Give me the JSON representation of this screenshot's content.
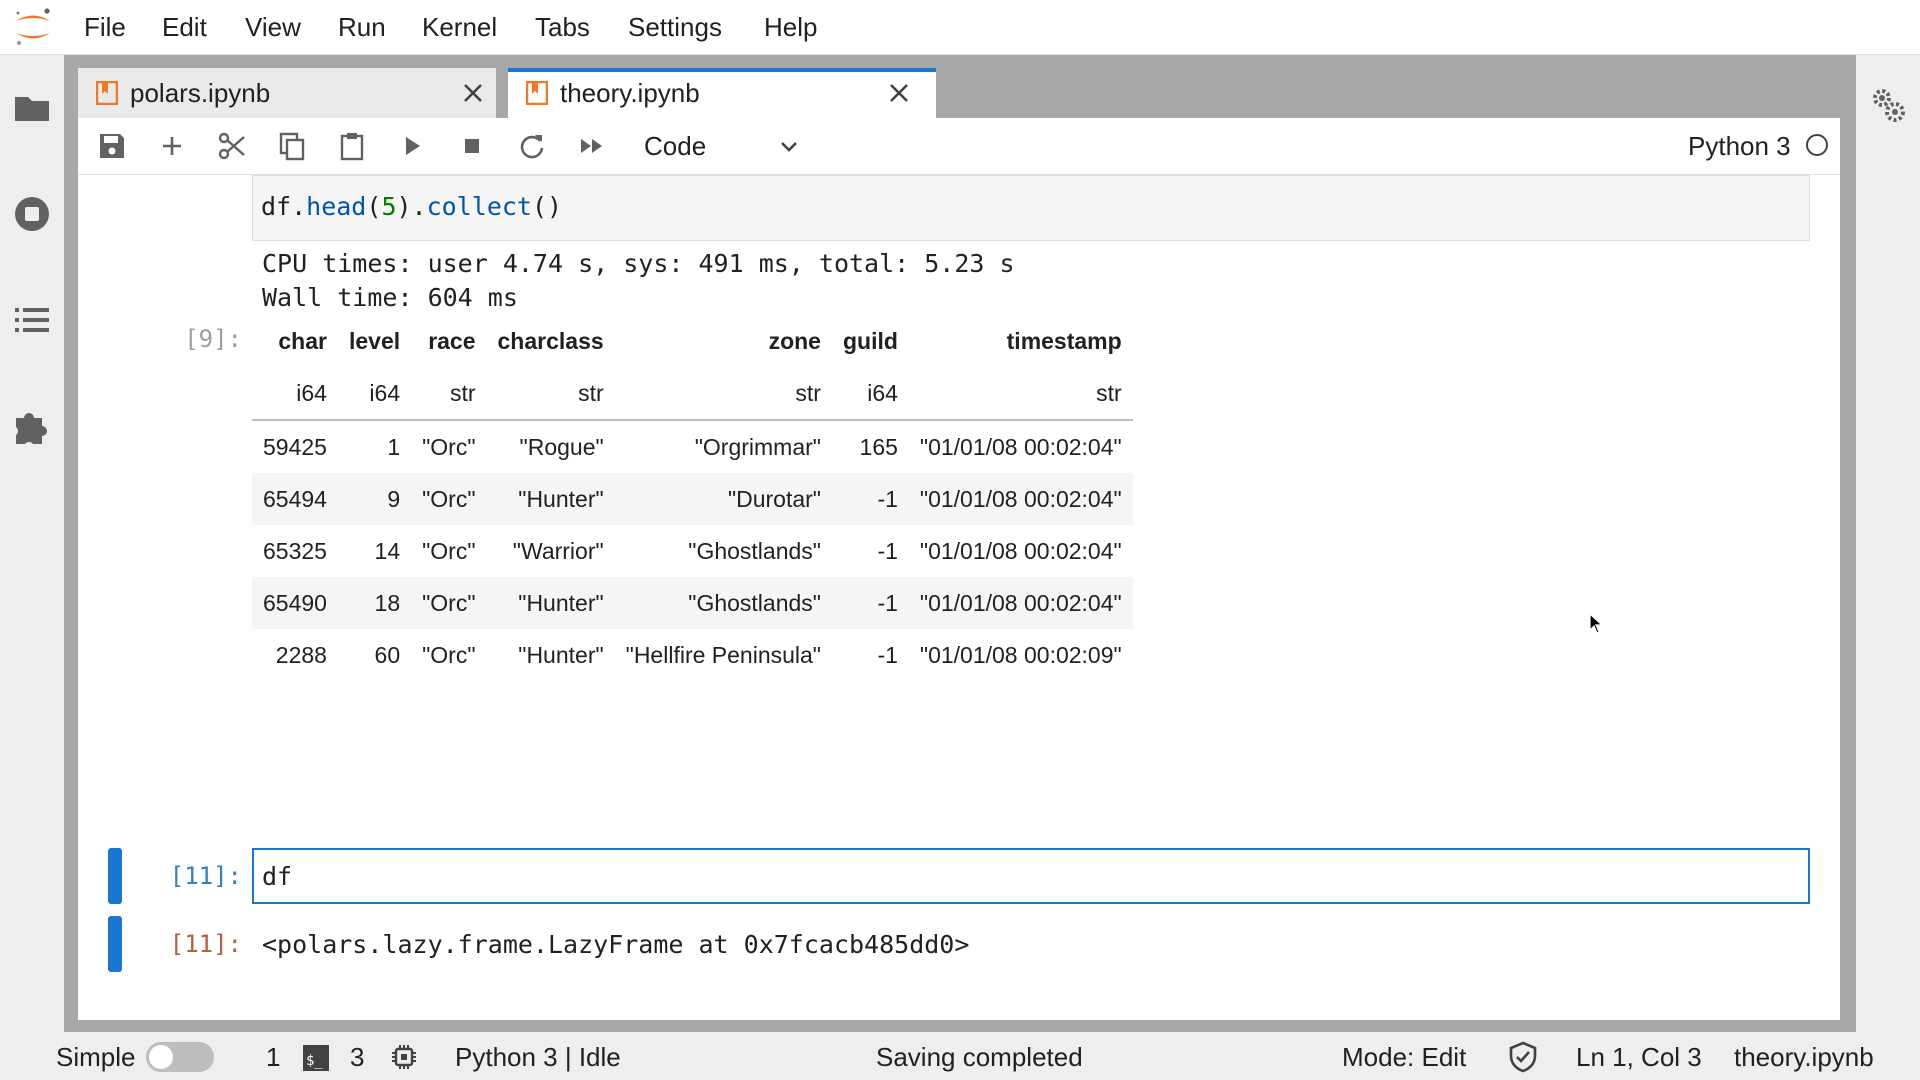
{
  "menu": {
    "items": [
      "File",
      "Edit",
      "View",
      "Run",
      "Kernel",
      "Tabs",
      "Settings",
      "Help"
    ]
  },
  "tabs": [
    {
      "label": "polars.ipynb",
      "active": false
    },
    {
      "label": "theory.ipynb",
      "active": true
    }
  ],
  "toolbar": {
    "cell_type": "Code",
    "kernel": "Python 3",
    "icons": [
      "save-icon",
      "add-cell-icon",
      "cut-icon",
      "copy-icon",
      "paste-icon",
      "run-icon",
      "stop-icon",
      "restart-icon",
      "run-all-icon"
    ]
  },
  "notebook": {
    "cell1": {
      "code": {
        "prefix": "df.",
        "fn1": "head",
        "open": "(",
        "num": "5",
        "close": ").",
        "fn2": "collect",
        "end": "()"
      },
      "output_lines": [
        "CPU times: user 4.74 s, sys: 491 ms, total: 5.23 s",
        "Wall time: 604 ms"
      ],
      "prompt": "[9]:"
    },
    "table": {
      "columns": [
        "char",
        "level",
        "race",
        "charclass",
        "zone",
        "guild",
        "timestamp"
      ],
      "dtypes": [
        "i64",
        "i64",
        "str",
        "str",
        "str",
        "i64",
        "str"
      ],
      "rows": [
        [
          "59425",
          "1",
          "\"Orc\"",
          "\"Rogue\"",
          "\"Orgrimmar\"",
          "165",
          "\"01/01/08 00:02:04\""
        ],
        [
          "65494",
          "9",
          "\"Orc\"",
          "\"Hunter\"",
          "\"Durotar\"",
          "-1",
          "\"01/01/08 00:02:04\""
        ],
        [
          "65325",
          "14",
          "\"Orc\"",
          "\"Warrior\"",
          "\"Ghostlands\"",
          "-1",
          "\"01/01/08 00:02:04\""
        ],
        [
          "65490",
          "18",
          "\"Orc\"",
          "\"Hunter\"",
          "\"Ghostlands\"",
          "-1",
          "\"01/01/08 00:02:04\""
        ],
        [
          "2288",
          "60",
          "\"Orc\"",
          "\"Hunter\"",
          "\"Hellfire Peninsula\"",
          "-1",
          "\"01/01/08 00:02:09\""
        ]
      ]
    },
    "cell2": {
      "in_prompt": "[11]:",
      "code": "df",
      "out_prompt": "[11]:",
      "output": "<polars.lazy.frame.LazyFrame at 0x7fcacb485dd0>"
    }
  },
  "statusbar": {
    "mode_label": "Simple",
    "terminals": "1",
    "kernels": "3",
    "kernel_status": "Python 3 | Idle",
    "message": "Saving completed",
    "edit_mode": "Mode: Edit",
    "position": "Ln 1, Col 3",
    "filename": "theory.ipynb"
  },
  "colors": {
    "accent": "#1976d2",
    "logo": "#f37726",
    "tab_icon": "#f37726"
  }
}
